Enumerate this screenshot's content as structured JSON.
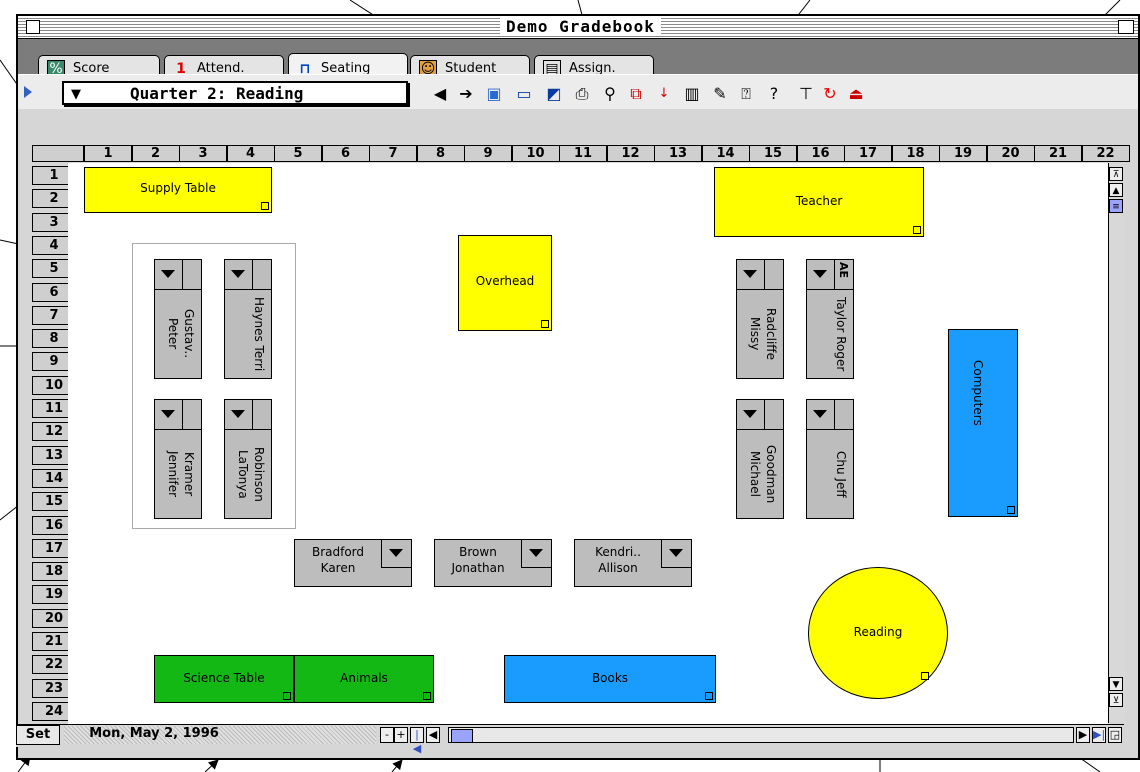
{
  "window": {
    "title": "Demo Gradebook"
  },
  "tabs": [
    {
      "label": "Score",
      "icon": "percent-icon"
    },
    {
      "label": "Attend.",
      "icon": "calendar-icon"
    },
    {
      "label": "Seating",
      "icon": "seating-icon"
    },
    {
      "label": "Student",
      "icon": "student-icon"
    },
    {
      "label": "Assign.",
      "icon": "assignment-icon"
    }
  ],
  "toolbar": {
    "class_selector": "Quarter 2: Reading"
  },
  "grid": {
    "columns": [
      "1",
      "2",
      "3",
      "4",
      "5",
      "6",
      "7",
      "8",
      "9",
      "10",
      "11",
      "12",
      "13",
      "14",
      "15",
      "16",
      "17",
      "18",
      "19",
      "20",
      "21",
      "22"
    ],
    "rows": [
      "1",
      "2",
      "3",
      "4",
      "5",
      "6",
      "7",
      "8",
      "9",
      "10",
      "11",
      "12",
      "13",
      "14",
      "15",
      "16",
      "17",
      "18",
      "19",
      "20",
      "21",
      "22",
      "23",
      "24"
    ]
  },
  "objects": {
    "supply_table": "Supply Table",
    "teacher": "Teacher",
    "overhead": "Overhead",
    "computers": "Computers",
    "science_table": "Science Table",
    "animals": "Animals",
    "books": "Books",
    "reading": "Reading"
  },
  "colors": {
    "yellow": "#ffff00",
    "blue": "#1a9cff",
    "green": "#14b814"
  },
  "desks": {
    "gustav": {
      "last": "Gustav..",
      "first": "Peter"
    },
    "haynes": {
      "last": "Haynes",
      "first": "Terri"
    },
    "kramer": {
      "last": "Kramer",
      "first": "Jennifer"
    },
    "robinson": {
      "last": "Robinson",
      "first": "LaTonya"
    },
    "radcliffe": {
      "last": "Radcliffe",
      "first": "Missy"
    },
    "taylor": {
      "last": "Taylor",
      "first": "Roger",
      "badge": "AE"
    },
    "goodman": {
      "last": "Goodman",
      "first": "Michael"
    },
    "chu": {
      "last": "Chu",
      "first": "Jeff"
    },
    "bradford": {
      "last": "Bradford",
      "first": "Karen"
    },
    "brown": {
      "last": "Brown",
      "first": "Jonathan"
    },
    "kendri": {
      "last": "Kendri..",
      "first": "Allison"
    }
  },
  "footer": {
    "set_label": "Set",
    "date": "Mon, May 2, 1996",
    "minus": "-",
    "plus": "+"
  }
}
